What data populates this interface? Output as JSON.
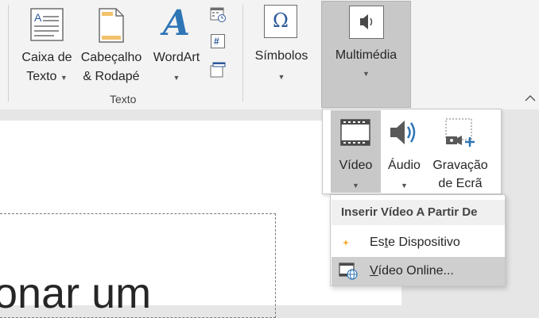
{
  "ribbon": {
    "groups": {
      "texto": {
        "label": "Texto",
        "caixa_de_texto": {
          "line1": "Caixa de",
          "line2": "Texto"
        },
        "cabecalho_rodape": {
          "line1": "Cabeçalho",
          "line2": "& Rodapé"
        },
        "wordart": {
          "label": "WordArt"
        }
      },
      "simbolos": {
        "label": "Símbolos"
      },
      "multimedia": {
        "label": "Multimédia"
      }
    },
    "wordart_glyph": "A",
    "omega_glyph": "Ω",
    "number_glyph": "#"
  },
  "multimedia_menu": {
    "video": {
      "label": "Vídeo"
    },
    "audio": {
      "label": "Áudio"
    },
    "screen_recording": {
      "line1": "Gravação",
      "line2": "de Ecrã"
    }
  },
  "video_menu": {
    "header": "Inserir Vídeo A Partir De",
    "items": [
      {
        "prefix": "Es",
        "underlined": "t",
        "suffix": "e Dispositivo"
      },
      {
        "prefix": "",
        "underlined": "V",
        "suffix": "ídeo Online..."
      }
    ]
  },
  "slide": {
    "visible_text": "onar um"
  },
  "colors": {
    "accent_blue": "#2b579a",
    "wordart_blue": "#2e75b6",
    "pressed_gray": "#c8c8c8",
    "header_bg": "#f0f0f0"
  }
}
